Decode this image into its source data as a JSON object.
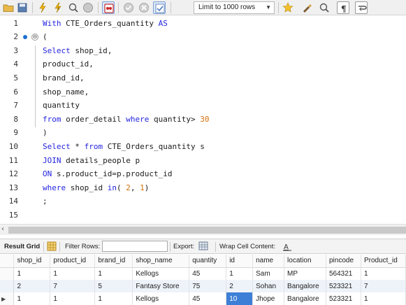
{
  "toolbar": {
    "limit_label": "Limit to 1000 rows",
    "buttons": [
      "folder-icon",
      "save-icon",
      "execute-icon",
      "execute-current-icon",
      "explain-icon",
      "stop-icon",
      "toggle-error-icon",
      "commit-icon",
      "rollback-icon",
      "autocommit-icon",
      "bookmark-icon",
      "beautify-icon",
      "find-icon",
      "invisible-chars-icon",
      "wrap-icon"
    ]
  },
  "editor": {
    "lines": [
      {
        "n": "1",
        "tokens": [
          {
            "t": "With",
            "c": "kw"
          },
          {
            "t": " CTE_Orders_quantity ",
            "c": "plain"
          },
          {
            "t": "AS",
            "c": "kw"
          }
        ]
      },
      {
        "n": "2",
        "tokens": [
          {
            "t": "(",
            "c": "plain"
          }
        ]
      },
      {
        "n": "3",
        "tokens": [
          {
            "t": "Select",
            "c": "kw"
          },
          {
            "t": " shop_id,",
            "c": "plain"
          }
        ]
      },
      {
        "n": "4",
        "tokens": [
          {
            "t": "product_id,",
            "c": "plain"
          }
        ]
      },
      {
        "n": "5",
        "tokens": [
          {
            "t": "brand_id,",
            "c": "plain"
          }
        ]
      },
      {
        "n": "6",
        "tokens": [
          {
            "t": "shop_name,",
            "c": "plain"
          }
        ]
      },
      {
        "n": "7",
        "tokens": [
          {
            "t": "quantity",
            "c": "plain"
          }
        ]
      },
      {
        "n": "8",
        "tokens": [
          {
            "t": "from",
            "c": "kw"
          },
          {
            "t": " order_detail ",
            "c": "plain"
          },
          {
            "t": "where",
            "c": "kw"
          },
          {
            "t": " quantity> ",
            "c": "plain"
          },
          {
            "t": "30",
            "c": "num"
          }
        ]
      },
      {
        "n": "9",
        "tokens": [
          {
            "t": ")",
            "c": "plain"
          }
        ]
      },
      {
        "n": "10",
        "tokens": [
          {
            "t": "Select",
            "c": "kw"
          },
          {
            "t": " * ",
            "c": "plain"
          },
          {
            "t": "from",
            "c": "kw"
          },
          {
            "t": " CTE_Orders_quantity s",
            "c": "plain"
          }
        ]
      },
      {
        "n": "11",
        "tokens": [
          {
            "t": "JOIN",
            "c": "kw"
          },
          {
            "t": " details_people p",
            "c": "plain"
          }
        ]
      },
      {
        "n": "12",
        "tokens": [
          {
            "t": "ON",
            "c": "kw"
          },
          {
            "t": " s.product_id=p.product_id",
            "c": "plain"
          }
        ]
      },
      {
        "n": "13",
        "tokens": [
          {
            "t": "where",
            "c": "kw"
          },
          {
            "t": " shop_id ",
            "c": "plain"
          },
          {
            "t": "in",
            "c": "kw"
          },
          {
            "t": "( ",
            "c": "plain"
          },
          {
            "t": "2",
            "c": "num"
          },
          {
            "t": ", ",
            "c": "plain"
          },
          {
            "t": "1",
            "c": "num"
          },
          {
            "t": ")",
            "c": "plain"
          }
        ]
      },
      {
        "n": "14",
        "tokens": [
          {
            "t": ";",
            "c": "plain"
          }
        ]
      },
      {
        "n": "15",
        "tokens": []
      }
    ]
  },
  "resultbar": {
    "tab": "Result Grid",
    "filter_label": "Filter Rows:",
    "filter_value": "",
    "export_label": "Export:",
    "wrap_label": "Wrap Cell Content:"
  },
  "grid": {
    "columns": [
      "shop_id",
      "product_id",
      "brand_id",
      "shop_name",
      "quantity",
      "id",
      "name",
      "location",
      "pincode",
      "Product_id"
    ],
    "rows": [
      [
        "1",
        "1",
        "1",
        "Kellogs",
        "45",
        "1",
        "Sam",
        "MP",
        "564321",
        "1"
      ],
      [
        "2",
        "7",
        "5",
        "Fantasy Store",
        "75",
        "2",
        "Sohan",
        "Bangalore",
        "523321",
        "7"
      ],
      [
        "1",
        "1",
        "1",
        "Kellogs",
        "45",
        "10",
        "Jhope",
        "Bangalore",
        "523321",
        "1"
      ]
    ]
  }
}
